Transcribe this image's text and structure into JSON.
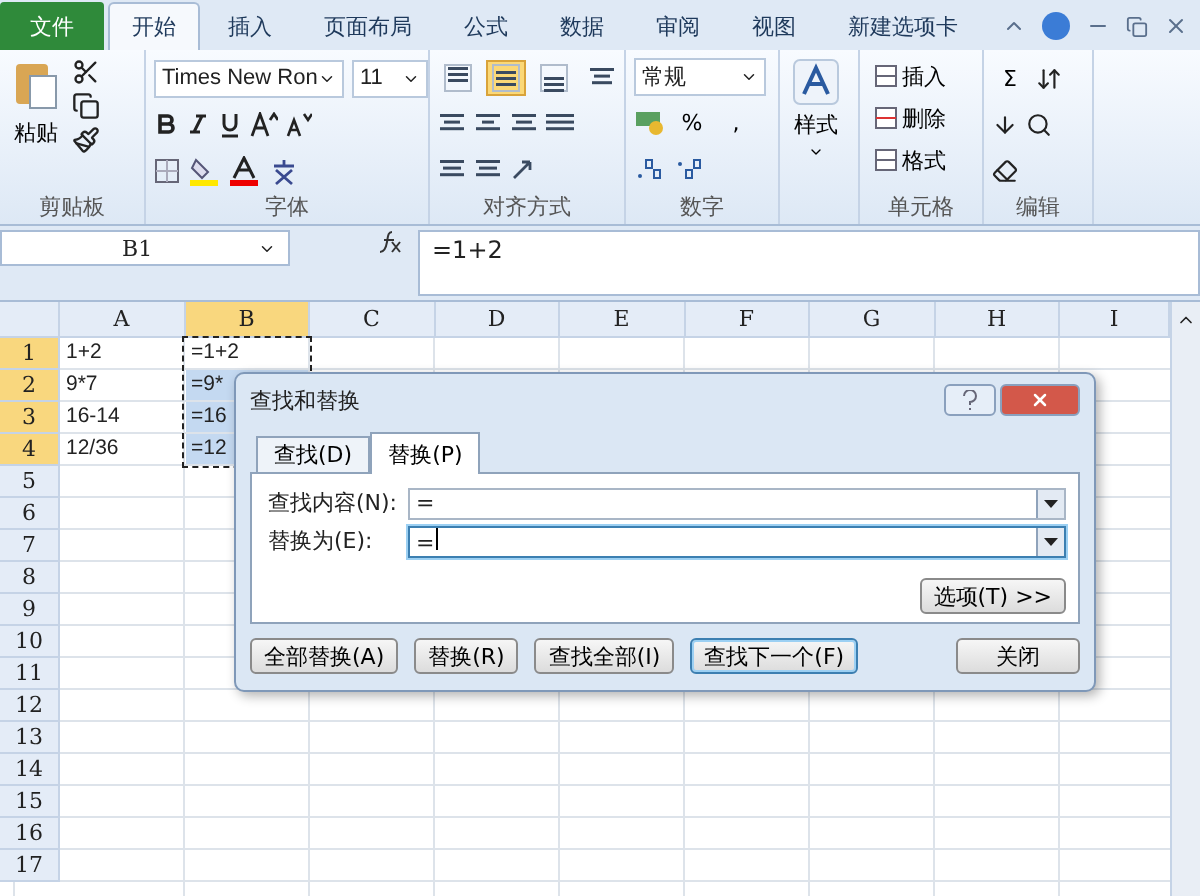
{
  "menu_tabs": [
    {
      "label": "文件",
      "kind": "file",
      "selected": false
    },
    {
      "label": "开始",
      "kind": "tab",
      "selected": true
    },
    {
      "label": "插入",
      "kind": "tab",
      "selected": false
    },
    {
      "label": "页面布局",
      "kind": "tab",
      "selected": false
    },
    {
      "label": "公式",
      "kind": "tab",
      "selected": false
    },
    {
      "label": "数据",
      "kind": "tab",
      "selected": false
    },
    {
      "label": "审阅",
      "kind": "tab",
      "selected": false
    },
    {
      "label": "视图",
      "kind": "tab",
      "selected": false
    },
    {
      "label": "新建选项卡",
      "kind": "tab",
      "selected": false
    }
  ],
  "ribbon": {
    "paste_label": "粘贴",
    "font_name": "Times New Ron",
    "font_size": "11",
    "vertical_align_buttons": [
      {
        "selected": false
      },
      {
        "selected": true
      },
      {
        "selected": false
      }
    ],
    "number_format": "常规",
    "number_symbols": [
      "%",
      ","
    ],
    "styles_label": "样式",
    "cell_buttons": [
      "插入",
      "删除",
      "格式"
    ],
    "sum_symbol": "Σ",
    "groups": [
      "剪贴板",
      "字体",
      "对齐方式",
      "数字",
      "单元格",
      "编辑"
    ]
  },
  "formula_bar": {
    "name_box": "B1",
    "formula": "=1+2"
  },
  "sheet": {
    "columns": [
      {
        "label": "A",
        "selected": false
      },
      {
        "label": "B",
        "selected": true
      },
      {
        "label": "C",
        "selected": false
      },
      {
        "label": "D",
        "selected": false
      },
      {
        "label": "E",
        "selected": false
      },
      {
        "label": "F",
        "selected": false
      },
      {
        "label": "G",
        "selected": false
      },
      {
        "label": "H",
        "selected": false
      },
      {
        "label": "I",
        "selected": false
      }
    ],
    "rows": [
      {
        "label": "1",
        "selected": true,
        "cells": [
          {
            "text": "1+2",
            "selected": false
          },
          {
            "text": "=1+2",
            "selected": false
          }
        ]
      },
      {
        "label": "2",
        "selected": true,
        "cells": [
          {
            "text": "9*7",
            "selected": false
          },
          {
            "text": "=9*",
            "selected": true
          }
        ]
      },
      {
        "label": "3",
        "selected": true,
        "cells": [
          {
            "text": "16-14",
            "selected": false
          },
          {
            "text": "=16",
            "selected": true
          }
        ]
      },
      {
        "label": "4",
        "selected": true,
        "cells": [
          {
            "text": "12/36",
            "selected": false
          },
          {
            "text": "=12",
            "selected": true
          }
        ]
      },
      {
        "label": "5",
        "selected": false
      },
      {
        "label": "6",
        "selected": false
      },
      {
        "label": "7",
        "selected": false
      },
      {
        "label": "8",
        "selected": false
      },
      {
        "label": "9",
        "selected": false
      },
      {
        "label": "10",
        "selected": false
      },
      {
        "label": "11",
        "selected": false
      },
      {
        "label": "12",
        "selected": false
      },
      {
        "label": "13",
        "selected": false
      },
      {
        "label": "14",
        "selected": false
      },
      {
        "label": "15",
        "selected": false
      },
      {
        "label": "16",
        "selected": false
      },
      {
        "label": "17",
        "selected": false
      }
    ]
  },
  "dialog": {
    "title": "查找和替换",
    "tabs": [
      {
        "label": "查找(D)",
        "selected": false
      },
      {
        "label": "替换(P)",
        "selected": true
      }
    ],
    "fields": [
      {
        "label": "查找内容(N):",
        "value": "=",
        "focused": false
      },
      {
        "label": "替换为(E):",
        "value": "=",
        "focused": true
      }
    ],
    "options_button": "选项(T) >>",
    "buttons": [
      {
        "label": "全部替换(A)",
        "default": false
      },
      {
        "label": "替换(R)",
        "default": false
      },
      {
        "label": "查找全部(I)",
        "default": false
      },
      {
        "label": "查找下一个(F)",
        "default": true
      },
      {
        "label": "关闭",
        "default": false
      }
    ]
  }
}
